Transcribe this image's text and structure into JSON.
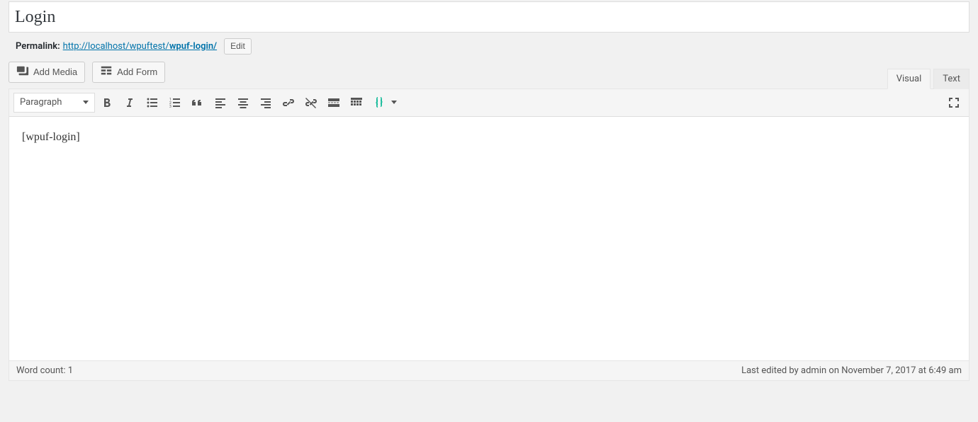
{
  "title": "Login",
  "permalink": {
    "label": "Permalink:",
    "base": "http://localhost/wpuftest/",
    "slug": "wpuf-login/",
    "edit_label": "Edit"
  },
  "media_button": "Add Media",
  "form_button": "Add Form",
  "tabs": {
    "visual": "Visual",
    "text": "Text"
  },
  "format_select": "Paragraph",
  "editor_body": "[wpuf-login]",
  "word_count_label": "Word count: 1",
  "last_edited": "Last edited by admin on November 7, 2017 at 6:49 am"
}
